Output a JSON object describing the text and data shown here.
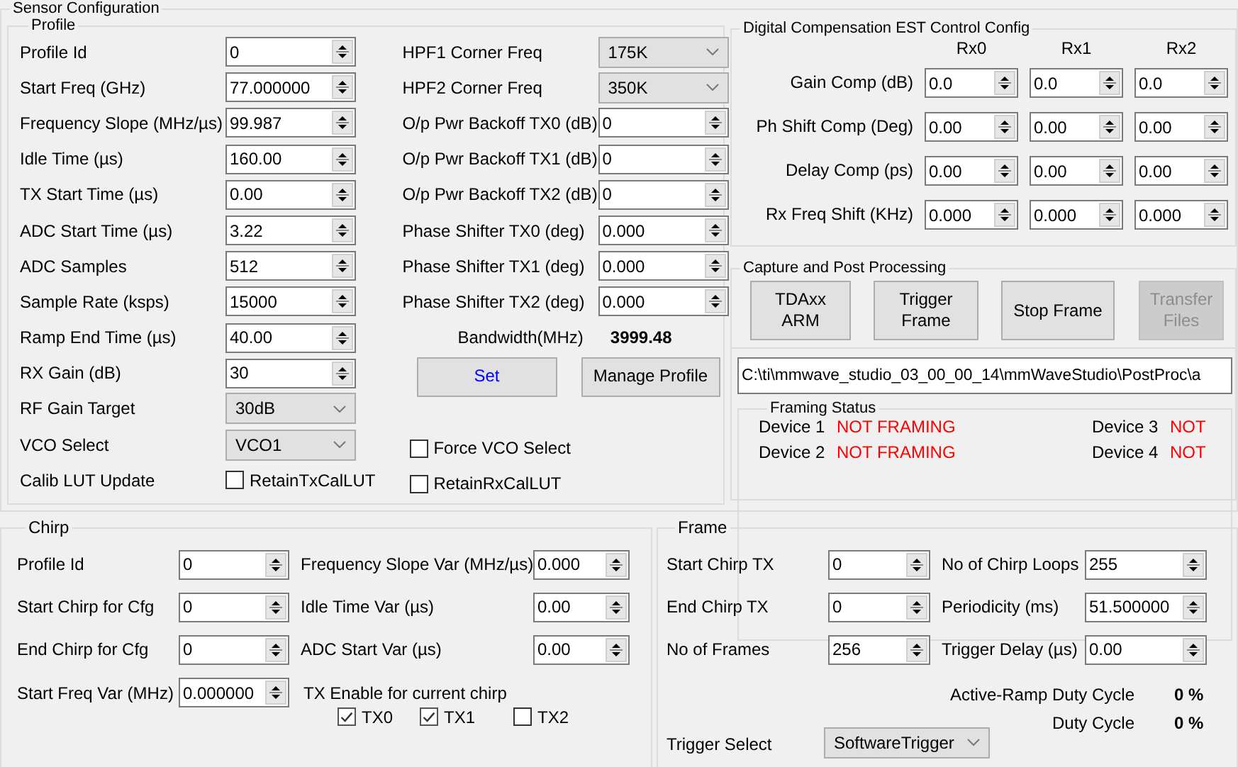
{
  "sensor_configuration": {
    "title": "Sensor Configuration",
    "profile": {
      "title": "Profile",
      "left_fields": [
        {
          "label": "Profile Id",
          "kind": "spin",
          "value": "0"
        },
        {
          "label": "Start Freq (GHz)",
          "kind": "spin",
          "value": "77.000000"
        },
        {
          "label": "Frequency Slope (MHz/µs)",
          "kind": "spin",
          "value": "99.987"
        },
        {
          "label": "Idle Time (µs)",
          "kind": "spin",
          "value": "160.00"
        },
        {
          "label": "TX Start Time (µs)",
          "kind": "spin",
          "value": "0.00"
        },
        {
          "label": "ADC Start Time (µs)",
          "kind": "spin",
          "value": "3.22"
        },
        {
          "label": "ADC Samples",
          "kind": "spin",
          "value": "512"
        },
        {
          "label": "Sample Rate (ksps)",
          "kind": "spin",
          "value": "15000"
        },
        {
          "label": "Ramp End Time (µs)",
          "kind": "spin",
          "value": "40.00"
        },
        {
          "label": "RX Gain (dB)",
          "kind": "spin",
          "value": "30"
        },
        {
          "label": "RF Gain Target",
          "kind": "combo",
          "value": "30dB"
        },
        {
          "label": "VCO Select",
          "kind": "combo",
          "value": "VCO1"
        },
        {
          "label": "Calib LUT Update",
          "kind": "check",
          "checkbox": {
            "label": "RetainTxCalLUT",
            "checked": false
          }
        }
      ],
      "right_fields": [
        {
          "label": "HPF1 Corner Freq",
          "kind": "combo",
          "value": "175K"
        },
        {
          "label": "HPF2 Corner Freq",
          "kind": "combo",
          "value": "350K"
        },
        {
          "label": "O/p Pwr Backoff TX0 (dB)",
          "kind": "spin",
          "value": "0"
        },
        {
          "label": "O/p Pwr Backoff TX1 (dB)",
          "kind": "spin",
          "value": "0"
        },
        {
          "label": "O/p Pwr Backoff TX2 (dB)",
          "kind": "spin",
          "value": "0"
        },
        {
          "label": "Phase Shifter TX0 (deg)",
          "kind": "spin",
          "value": "0.000"
        },
        {
          "label": "Phase Shifter TX1 (deg)",
          "kind": "spin",
          "value": "0.000"
        },
        {
          "label": "Phase Shifter TX2 (deg)",
          "kind": "spin",
          "value": "0.000"
        }
      ],
      "bandwidth": {
        "label": "Bandwidth(MHz)",
        "value": "3999.48"
      },
      "buttons": [
        {
          "label": "Set",
          "kind": "accent"
        },
        {
          "label": "Manage Profile",
          "kind": "normal"
        }
      ],
      "force_vco_select": {
        "label": "Force VCO Select",
        "checked": false
      },
      "retain_rx_cal_lut": {
        "label": "RetainRxCalLUT",
        "checked": false
      }
    },
    "digital_compensation": {
      "title": "Digital Compensation EST Control Config",
      "columns": [
        "Rx0",
        "Rx1",
        "Rx2"
      ],
      "rows": [
        {
          "label": "Gain Comp (dB)",
          "values": [
            "0.0",
            "0.0",
            "0.0"
          ]
        },
        {
          "label": "Ph Shift Comp (Deg)",
          "values": [
            "0.00",
            "0.00",
            "0.00"
          ]
        },
        {
          "label": "Delay Comp (ps)",
          "values": [
            "0.00",
            "0.00",
            "0.00"
          ]
        },
        {
          "label": "Rx Freq Shift (KHz)",
          "values": [
            "0.000",
            "0.000",
            "0.000"
          ]
        }
      ]
    },
    "capture": {
      "title": "Capture and Post Processing",
      "buttons": [
        {
          "label": "TDAxx ARM",
          "disabled": false
        },
        {
          "label": "Trigger Frame",
          "disabled": false
        },
        {
          "label": "Stop Frame",
          "disabled": false
        },
        {
          "label": "Transfer Files",
          "disabled": true
        }
      ],
      "path": "C:\\ti\\mmwave_studio_03_00_00_14\\mmWaveStudio\\PostProc\\a",
      "framing_status": {
        "title": "Framing Status",
        "devices": [
          {
            "label": "Device 1",
            "status": "NOT FRAMING"
          },
          {
            "label": "Device 3",
            "status": "NOT"
          },
          {
            "label": "Device 2",
            "status": "NOT FRAMING"
          },
          {
            "label": "Device 4",
            "status": "NOT"
          }
        ]
      }
    }
  },
  "chirp": {
    "title": "Chirp",
    "left_fields": [
      {
        "label": "Profile Id",
        "value": "0"
      },
      {
        "label": "Start Chirp for Cfg",
        "value": "0"
      },
      {
        "label": "End Chirp for Cfg",
        "value": "0"
      },
      {
        "label": "Start Freq Var (MHz)",
        "value": "0.000000"
      }
    ],
    "right_fields": [
      {
        "label": "Frequency Slope Var (MHz/µs)",
        "value": "0.000"
      },
      {
        "label": "Idle Time Var (µs)",
        "value": "0.00"
      },
      {
        "label": "ADC Start Var (µs)",
        "value": "0.00"
      }
    ],
    "tx_enable": {
      "label": "TX Enable for current chirp",
      "checkboxes": [
        {
          "label": "TX0",
          "checked": true
        },
        {
          "label": "TX1",
          "checked": true
        },
        {
          "label": "TX2",
          "checked": false
        }
      ]
    }
  },
  "frame": {
    "title": "Frame",
    "left_fields": [
      {
        "label": "Start Chirp TX",
        "value": "0"
      },
      {
        "label": "End Chirp TX",
        "value": "0"
      },
      {
        "label": "No of Frames",
        "value": "256"
      }
    ],
    "right_fields": [
      {
        "label": "No of Chirp Loops",
        "value": "255"
      },
      {
        "label": "Periodicity (ms)",
        "value": "51.500000"
      },
      {
        "label": "Trigger Delay (µs)",
        "value": "0.00"
      }
    ],
    "active_ramp_duty_cycle": {
      "label": "Active-Ramp Duty Cycle",
      "value": "0 %"
    },
    "trigger_select": {
      "label": "Trigger Select",
      "value": "SoftwareTrigger"
    },
    "duty_cycle": {
      "label": "Duty Cycle",
      "value": "0 %"
    }
  }
}
